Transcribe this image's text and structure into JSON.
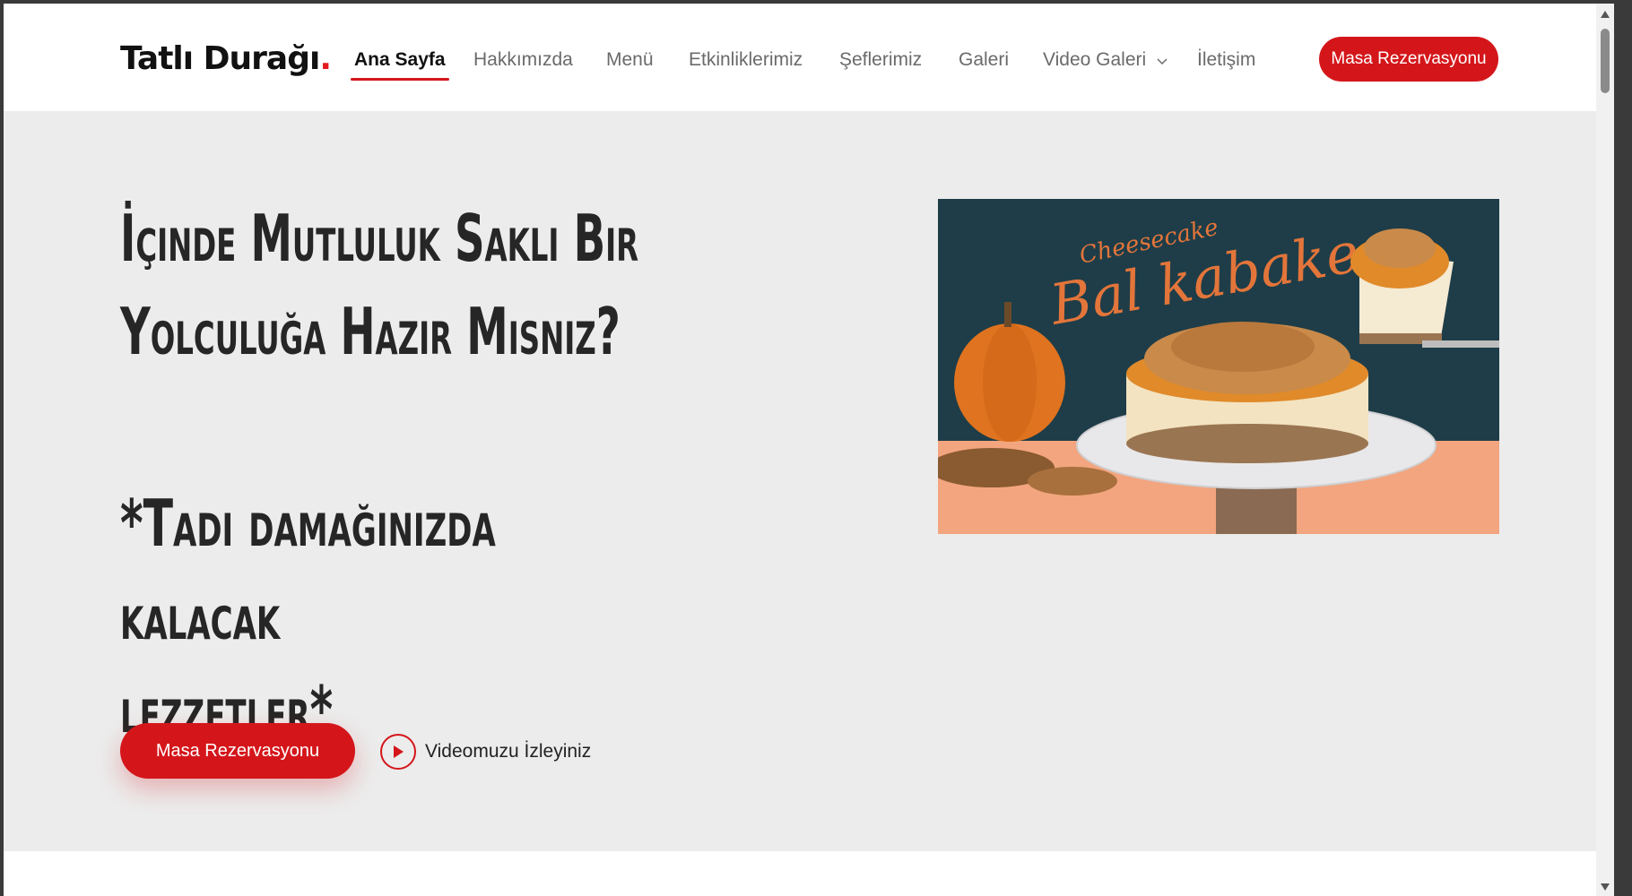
{
  "header": {
    "logo_text": "Tatlı Durağı",
    "logo_dot": ".",
    "nav": [
      {
        "label": "Ana Sayfa",
        "active": true
      },
      {
        "label": "Hakkımızda"
      },
      {
        "label": "Menü"
      },
      {
        "label": "Etkinliklerimiz"
      },
      {
        "label": "Şeflerimiz"
      },
      {
        "label": "Galeri"
      },
      {
        "label": "Video Galeri",
        "has_dropdown": true
      },
      {
        "label": "İletişim"
      }
    ],
    "cta_label": "Masa Rezervasyonu"
  },
  "hero": {
    "title_line1": "İçinde Mutluluk Saklı Bir",
    "title_line2": "Yolculuğa Hazır Mısnız?",
    "subtitle_line1": "*Tadı damağınızda kalacak",
    "subtitle_line2": "lezzetler*",
    "primary_button": "Masa Rezervasyonu",
    "video_link": "Videomuzu İzleyiniz",
    "image": {
      "script_text_small": "Cheesecake",
      "script_text_large": "Bal kabake",
      "colors": {
        "background": "#1e3d48",
        "floor": "#f2a57e",
        "pumpkin": "#e0731f"
      }
    }
  },
  "colors": {
    "accent": "#d4161b",
    "hero_bg": "#ececec"
  }
}
